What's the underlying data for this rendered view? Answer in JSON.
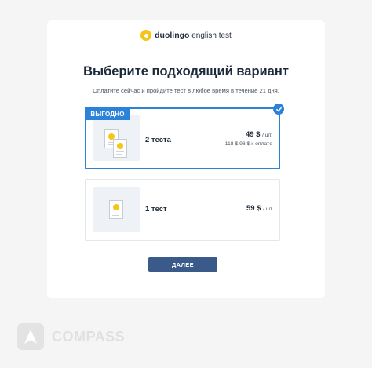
{
  "brand": {
    "name_bold": "duolingo",
    "name_rest": " english test",
    "logo_icon": "duolingo-logo"
  },
  "heading": {
    "title": "Выберите подходящий вариант",
    "subtitle": "Оплатите сейчас и пройдите тест в любое время в течение 21 дня."
  },
  "options": [
    {
      "badge": "ВЫГОДНО",
      "label": "2 теста",
      "price": "49 $",
      "unit": "/ шт.",
      "old_price": "118 $",
      "total": "98 $ к оплате",
      "selected": true
    },
    {
      "label": "1 тест",
      "price": "59 $",
      "unit": "/ шт.",
      "selected": false
    }
  ],
  "next_button": {
    "label": "ДАЛЕЕ"
  },
  "watermark": {
    "text": "COMPASS",
    "icon": "compass-logo"
  },
  "colors": {
    "accent": "#2b82d9",
    "button": "#3a5b8a",
    "brand_yellow": "#f5c518",
    "background": "#f5f5f5"
  }
}
